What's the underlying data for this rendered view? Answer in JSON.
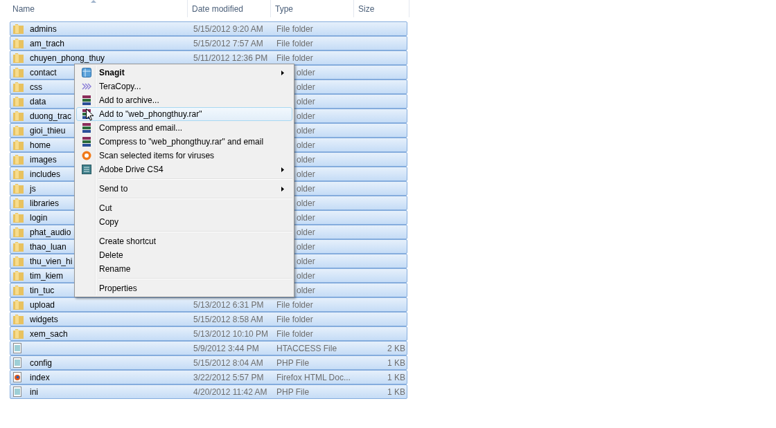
{
  "columns": [
    {
      "label": "Name",
      "sorted": true
    },
    {
      "label": "Date modified",
      "sorted": false
    },
    {
      "label": "Type",
      "sorted": false
    },
    {
      "label": "Size",
      "sorted": false
    }
  ],
  "rows": [
    {
      "kind": "folder",
      "name": "admins",
      "date": "5/15/2012 9:20 AM",
      "type": "File folder",
      "selected": true
    },
    {
      "kind": "folder",
      "name": "am_trach",
      "date": "5/15/2012 7:57 AM",
      "type": "File folder",
      "selected": true
    },
    {
      "kind": "folder",
      "name": "chuyen_phong_thuy",
      "date": "5/11/2012 12:36 PM",
      "type": "File folder",
      "selected": true
    },
    {
      "kind": "folder",
      "name": "contact",
      "type": "older",
      "selected": true
    },
    {
      "kind": "folder",
      "name": "css",
      "type": "older",
      "selected": true
    },
    {
      "kind": "folder",
      "name": "data",
      "type": "older",
      "selected": true
    },
    {
      "kind": "folder",
      "name": "duong_trac",
      "type": "older",
      "selected": true
    },
    {
      "kind": "folder",
      "name": "gioi_thieu",
      "type": "older",
      "selected": true
    },
    {
      "kind": "folder",
      "name": "home",
      "type": "older",
      "selected": true
    },
    {
      "kind": "folder",
      "name": "images",
      "type": "older",
      "selected": true
    },
    {
      "kind": "folder",
      "name": "includes",
      "type": "older",
      "selected": true
    },
    {
      "kind": "folder",
      "name": "js",
      "type": "older",
      "selected": true
    },
    {
      "kind": "folder",
      "name": "libraries",
      "type": "older",
      "selected": true
    },
    {
      "kind": "folder",
      "name": "login",
      "type": "older",
      "selected": true
    },
    {
      "kind": "folder",
      "name": "phat_audio",
      "type": "older",
      "selected": true
    },
    {
      "kind": "folder",
      "name": "thao_luan",
      "type": "older",
      "selected": true
    },
    {
      "kind": "folder",
      "name": "thu_vien_hi",
      "type": "older",
      "selected": true
    },
    {
      "kind": "folder",
      "name": "tim_kiem",
      "type": "older",
      "selected": true
    },
    {
      "kind": "folder",
      "name": "tin_tuc",
      "type": "older",
      "selected": true
    },
    {
      "kind": "folder",
      "name": "upload",
      "date": "5/13/2012 6:31 PM",
      "type": "File folder",
      "selected": true
    },
    {
      "kind": "folder",
      "name": "widgets",
      "date": "5/15/2012 8:58 AM",
      "type": "File folder",
      "selected": true
    },
    {
      "kind": "folder",
      "name": "xem_sach",
      "date": "5/13/2012 10:10 PM",
      "type": "File folder",
      "selected": true
    },
    {
      "kind": "file",
      "date": "5/9/2012 3:44 PM",
      "type": "HTACCESS File",
      "size": "2 KB",
      "selected": true
    },
    {
      "kind": "file",
      "name": "config",
      "date": "5/15/2012 8:04 AM",
      "type": "PHP File",
      "size": "1 KB",
      "selected": true
    },
    {
      "kind": "web",
      "name": "index",
      "date": "3/22/2012 5:57 PM",
      "type": "Firefox HTML Doc...",
      "size": "1 KB",
      "selected": true
    },
    {
      "kind": "file",
      "name": "ini",
      "date": "4/20/2012 11:42 AM",
      "type": "PHP File",
      "size": "1 KB",
      "selected": true
    }
  ],
  "context_menu": [
    {
      "kind": "grid",
      "label": "Snagit",
      "bold": true,
      "submenu": true,
      "selected": false
    },
    {
      "kind": "chevrons",
      "label": "TeraCopy...",
      "selected": false
    },
    {
      "kind": "archive",
      "label": "Add to archive...",
      "selected": false
    },
    {
      "kind": "archive",
      "label": "Add to \"web_phongthuy.rar\"",
      "selected": true
    },
    {
      "kind": "archive",
      "label": "Compress and email...",
      "selected": false
    },
    {
      "kind": "archive",
      "label": "Compress to \"web_phongthuy.rar\" and email",
      "selected": false
    },
    {
      "kind": "scan",
      "label": "Scan selected items for viruses",
      "selected": false
    },
    {
      "kind": "drive",
      "label": "Adobe Drive CS4",
      "submenu": true,
      "selected": false
    },
    {
      "kind": "separator"
    },
    {
      "kind": "item",
      "label": "Send to",
      "submenu": true,
      "selected": false
    },
    {
      "kind": "separator"
    },
    {
      "kind": "item",
      "label": "Cut",
      "selected": false
    },
    {
      "kind": "item",
      "label": "Copy",
      "selected": false
    },
    {
      "kind": "separator"
    },
    {
      "kind": "item",
      "label": "Create shortcut",
      "selected": false
    },
    {
      "kind": "item",
      "label": "Delete",
      "selected": false
    },
    {
      "kind": "item",
      "label": "Rename",
      "selected": false
    },
    {
      "kind": "separator"
    },
    {
      "kind": "item",
      "label": "Properties",
      "selected": false
    }
  ]
}
